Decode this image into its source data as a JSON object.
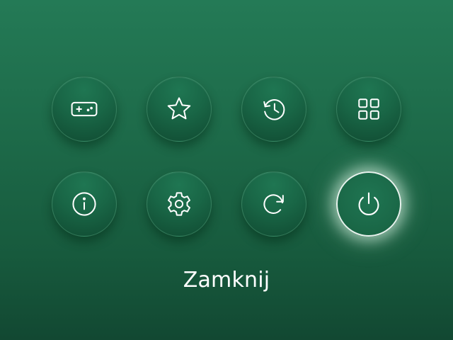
{
  "menu": {
    "items": [
      {
        "icon": "gamepad-icon"
      },
      {
        "icon": "star-icon"
      },
      {
        "icon": "history-icon"
      },
      {
        "icon": "grid-icon"
      },
      {
        "icon": "info-icon"
      },
      {
        "icon": "gear-icon"
      },
      {
        "icon": "refresh-icon"
      },
      {
        "icon": "power-icon"
      }
    ],
    "selected_index": 7,
    "selected_label": "Zamknij"
  },
  "colors": {
    "background": "#1d6a49",
    "button": "#196646",
    "icon": "#ffffff",
    "selected_border": "#e9f3ee"
  }
}
